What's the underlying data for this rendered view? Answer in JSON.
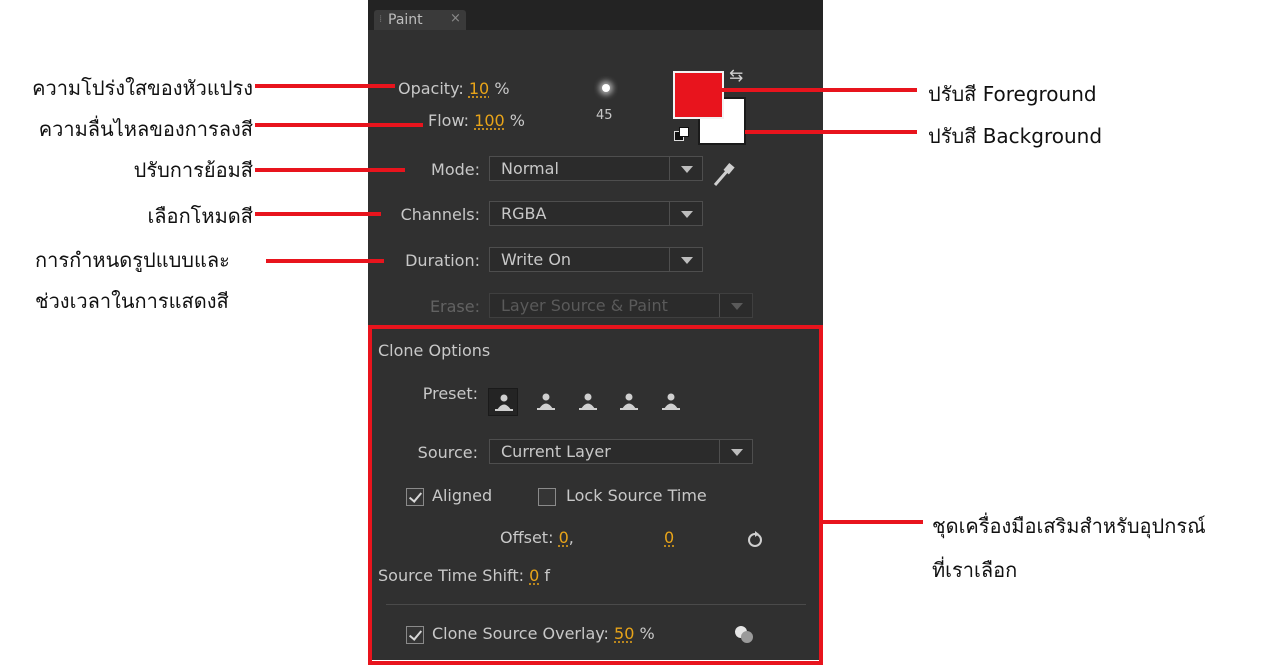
{
  "panel": {
    "tab_title": "Paint",
    "opacity": {
      "label": "Opacity:",
      "value": "10",
      "unit": "%"
    },
    "flow": {
      "label": "Flow:",
      "value": "100",
      "unit": "%"
    },
    "brush_size": "45",
    "mode": {
      "label": "Mode:",
      "value": "Normal"
    },
    "channels": {
      "label": "Channels:",
      "value": "RGBA"
    },
    "duration": {
      "label": "Duration:",
      "value": "Write On"
    },
    "erase": {
      "label": "Erase:",
      "value": "Layer Source & Paint"
    },
    "foreground_color": "#e8141d",
    "background_color": "#ffffff",
    "clone_options": {
      "heading": "Clone Options",
      "preset_label": "Preset:",
      "source_label": "Source:",
      "source_value": "Current Layer",
      "aligned_label": "Aligned",
      "aligned_checked": true,
      "lock_source_time_label": "Lock Source Time",
      "lock_source_time_checked": false,
      "offset_label": "Offset:",
      "offset_x": "0",
      "offset_sep": ",",
      "offset_y": "0",
      "source_time_shift_label": "Source Time Shift:",
      "source_time_shift_value": "0",
      "source_time_shift_unit": "f",
      "overlay_label": "Clone Source Overlay:",
      "overlay_value": "50",
      "overlay_unit": "%",
      "overlay_checked": true
    }
  },
  "annotations": {
    "opacity": "ความโปร่งใสของหัวแปรง",
    "flow": "ความลื่นไหลของการลงสี",
    "mode": "ปรับการย้อมสี",
    "channels": "เลือกโหมดสี",
    "duration_line1": "การกำหนดรูปแบบและ",
    "duration_line2": "ช่วงเวลาในการแสดงสี",
    "foreground": "ปรับสี Foreground",
    "background": "ปรับสี Background",
    "clone_line1": "ชุดเครื่องมือเสริมสำหรับอุปกรณ์",
    "clone_line2": "ที่เราเลือก"
  },
  "colors": {
    "annotation_red": "#e8141d",
    "value_orange": "#e8a419",
    "panel_bg": "#303030"
  }
}
